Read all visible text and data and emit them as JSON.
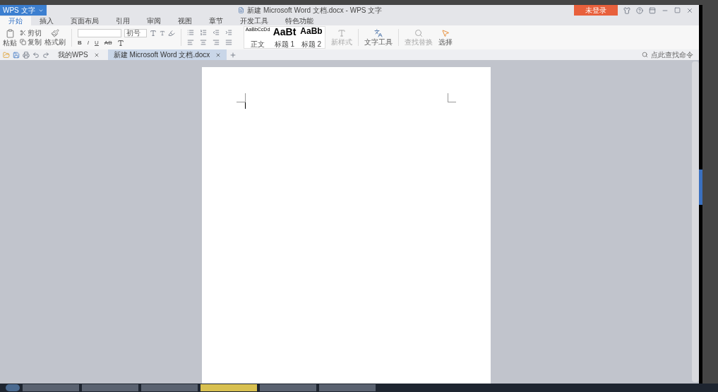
{
  "app_menu": {
    "label": "WPS 文字"
  },
  "window": {
    "title": "新建 Microsoft Word 文档.docx - WPS 文字"
  },
  "login_button": {
    "label": "未登录"
  },
  "ribbon_tabs": [
    {
      "label": "开始",
      "selected": true
    },
    {
      "label": "插入",
      "selected": false
    },
    {
      "label": "页面布局",
      "selected": false
    },
    {
      "label": "引用",
      "selected": false
    },
    {
      "label": "审阅",
      "selected": false
    },
    {
      "label": "视图",
      "selected": false
    },
    {
      "label": "章节",
      "selected": false
    },
    {
      "label": "开发工具",
      "selected": false
    },
    {
      "label": "特色功能",
      "selected": false
    }
  ],
  "clipboard": {
    "paste": "粘贴",
    "cut": "剪切",
    "copy": "复制",
    "format_painter": "格式刷"
  },
  "font": {
    "size": "初号",
    "buttons": [
      "B",
      "I",
      "U",
      "AB"
    ]
  },
  "styles": [
    {
      "kind": "body",
      "preview": "AaBbCcDd",
      "label": "正文"
    },
    {
      "kind": "heading1",
      "preview": "AaBt",
      "label": "标题 1"
    },
    {
      "kind": "heading2",
      "preview": "AaBb",
      "label": "标题 2"
    }
  ],
  "tools": {
    "new_style": "新样式",
    "text_tools": "文字工具",
    "find_replace": "查找替换",
    "select": "选择"
  },
  "doc_tabs": [
    {
      "label": "我的WPS",
      "selected": false
    },
    {
      "label": "新建 Microsoft Word 文档.docx",
      "selected": true
    }
  ],
  "command_search": {
    "placeholder": "点此查找命令"
  }
}
